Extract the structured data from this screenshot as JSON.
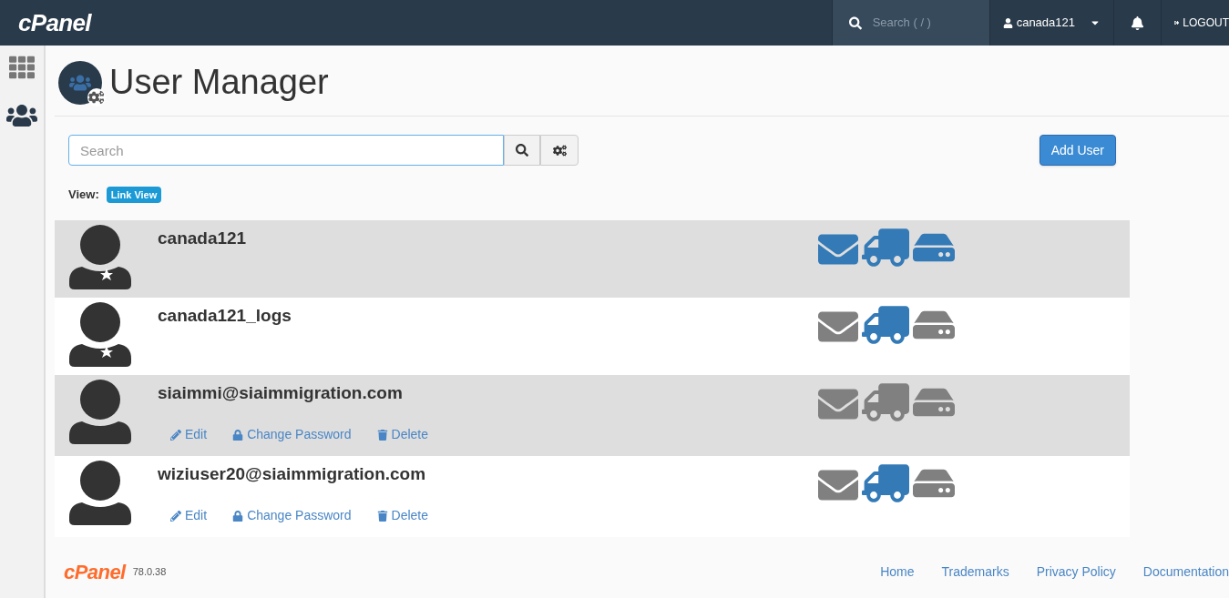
{
  "header": {
    "logo": "cPanel",
    "search_placeholder": "Search ( / )",
    "user": "canada121",
    "logout": "LOGOUT"
  },
  "page": {
    "title": "User Manager",
    "search_placeholder": "Search",
    "add_button": "Add User",
    "view_label": "View:",
    "view_badge": "Link View"
  },
  "users": [
    {
      "name": "canada121",
      "system_user": true,
      "email": true,
      "ftp": true,
      "webdisk": true
    },
    {
      "name": "canada121_logs",
      "system_user": true,
      "email": false,
      "ftp": true,
      "webdisk": false
    },
    {
      "name": "siaimmi@siaimmigration.com",
      "system_user": false,
      "email": false,
      "ftp": false,
      "webdisk": false,
      "actions": [
        {
          "kind": "edit",
          "label": "Edit"
        },
        {
          "kind": "password",
          "label": "Change Password"
        },
        {
          "kind": "delete",
          "label": "Delete"
        }
      ]
    },
    {
      "name": "wiziuser20@siaimmigration.com",
      "system_user": false,
      "email": false,
      "ftp": true,
      "webdisk": false,
      "actions": [
        {
          "kind": "edit",
          "label": "Edit"
        },
        {
          "kind": "password",
          "label": "Change Password"
        },
        {
          "kind": "delete",
          "label": "Delete"
        }
      ]
    }
  ],
  "footer": {
    "logo": "cPanel",
    "version": "78.0.38",
    "links": [
      "Home",
      "Trademarks",
      "Privacy Policy",
      "Documentation"
    ]
  }
}
